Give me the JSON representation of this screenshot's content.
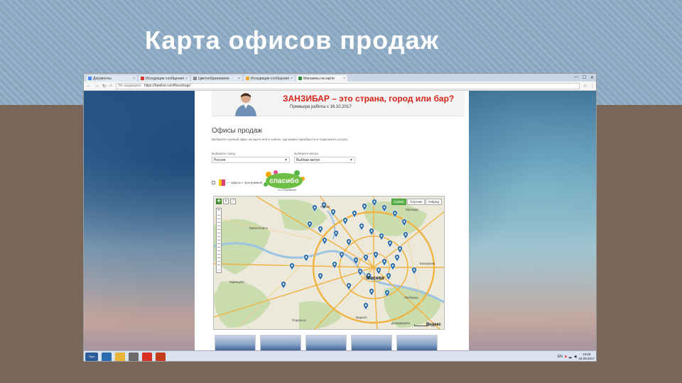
{
  "slide": {
    "title": "Карта офисов продаж"
  },
  "browser": {
    "tabs": [
      {
        "label": "Документы",
        "favicon_color": "#4285f4",
        "active": false
      },
      {
        "label": "Исходящие сообщения",
        "favicon_color": "#d93025",
        "active": false
      },
      {
        "label": "Цветообразование",
        "favicon_color": "#888888",
        "active": false
      },
      {
        "label": "Исходящие сообщения",
        "favicon_color": "#f5a623",
        "active": false
      },
      {
        "label": "Магазины на карте",
        "favicon_color": "#2b8a3e",
        "active": true
      }
    ],
    "url_prefix": "Не защищено",
    "url": "https://beeline.ru/offices/map/",
    "close_glyph": "×"
  },
  "banner": {
    "headline": "ЗАНЗИБАР – это страна, город или бар?",
    "subline": "Премьера работы с 16.10.2017"
  },
  "page": {
    "title": "Офисы продаж",
    "description": "Выберите нужный офис на карте или в списке, где можно приобрести и подключить услуги",
    "city_label": "выберите город",
    "city_value": "Россия",
    "metro_label": "выберите метро",
    "metro_value": "Выбери метро",
    "filter_label": "— офисы с программой",
    "spasibo_text": "спасибо",
    "spasibo_sub": "от Сбербанка"
  },
  "map": {
    "types": [
      "Схема",
      "Спутник",
      "Гибрид"
    ],
    "active_type": "Схема",
    "moscow_label": "Москва",
    "city_labels": [
      "Красногорск",
      "Одинцово",
      "Химки",
      "Мытищи",
      "Балашиха",
      "Люберцы",
      "Видное",
      "Домодедово",
      "Подольск"
    ],
    "logo": "Яндекс",
    "office_count": 42
  },
  "taskbar": {
    "start": "Пуск",
    "lang": "EN",
    "time": "10:55",
    "date": "18.09.2017",
    "icons": [
      {
        "name": "ie",
        "color": "#2b6cb0"
      },
      {
        "name": "explorer",
        "color": "#e8b43a"
      },
      {
        "name": "media",
        "color": "#6a6a6a"
      },
      {
        "name": "chrome",
        "color": "#d93025"
      },
      {
        "name": "powerpoint",
        "color": "#c43e1c"
      }
    ]
  }
}
